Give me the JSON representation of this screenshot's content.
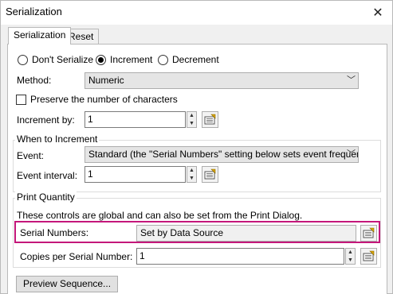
{
  "window": {
    "title": "Serialization"
  },
  "tabs": [
    {
      "label": "Serialization"
    },
    {
      "label": "Reset"
    }
  ],
  "mode": {
    "options": [
      "Don't Serialize",
      "Increment",
      "Decrement"
    ],
    "selected": "Increment"
  },
  "method": {
    "label": "Method:",
    "value": "Numeric"
  },
  "preserve": {
    "label": "Preserve the number of characters",
    "checked": false
  },
  "increment_by": {
    "label": "Increment by:",
    "value": "1"
  },
  "when": {
    "title": "When to Increment",
    "event_label": "Event:",
    "event_value": "Standard (the \"Serial Numbers\" setting below sets event frequency)",
    "interval_label": "Event interval:",
    "interval_value": "1"
  },
  "print_quantity": {
    "title": "Print Quantity",
    "note": "These controls are global and can also be set from the Print Dialog.",
    "serial_label": "Serial Numbers:",
    "serial_value": "Set by Data Source",
    "copies_label": "Copies per Serial Number:",
    "copies_value": "1"
  },
  "preview_button": "Preview Sequence...",
  "colors": {
    "highlight": "#c4177a"
  },
  "icons": [
    "close-icon",
    "radio-icon",
    "chevron-down-icon",
    "spin-up-icon",
    "spin-down-icon",
    "data-source-icon"
  ]
}
